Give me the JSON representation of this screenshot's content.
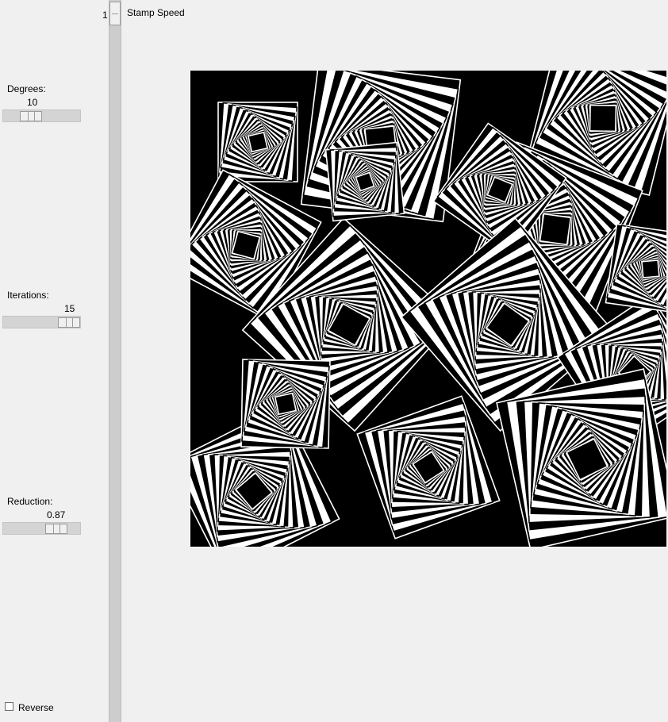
{
  "controls": {
    "stamp_speed": {
      "label": "Stamp Speed",
      "value": "1"
    },
    "degrees": {
      "label": "Degrees:",
      "value": "10",
      "fraction": 0.36
    },
    "iterations": {
      "label": "Iterations:",
      "value": "15",
      "fraction": 0.84
    },
    "reduction": {
      "label": "Reduction:",
      "value": "0.87",
      "fraction": 0.67
    },
    "reverse": {
      "label": "Reverse",
      "checked": false
    }
  },
  "canvas": {
    "background": "#000000",
    "stroke": "#ffffff",
    "description_icon": "fractal-square-spirals"
  }
}
